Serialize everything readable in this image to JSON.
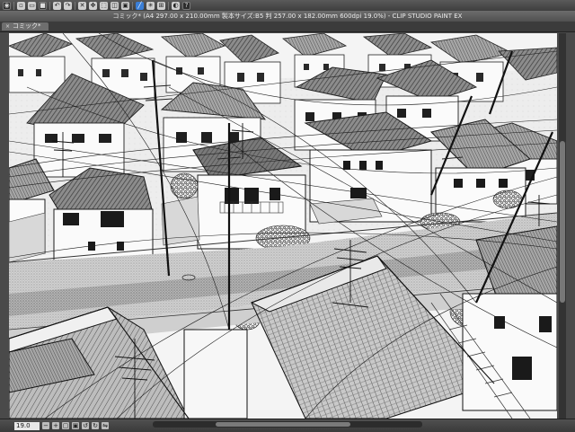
{
  "app": {
    "window_title": "コミック* (A4 297.00 x 210.00mm 製本サイズ:B5 判 257.00 x 182.00mm 600dpi 19.0%) - CLIP STUDIO PAINT EX"
  },
  "toolbar": {
    "icons": [
      "clip-studio-icon",
      "new-file-icon",
      "open-icon",
      "save-icon",
      "undo-icon",
      "redo-icon",
      "clear-icon",
      "transform-icon",
      "deselect-icon",
      "invert-icon",
      "border-icon",
      "snap-ruler-icon",
      "snap-special-ruler-icon",
      "snap-grid-icon",
      "color-icon",
      "help-icon"
    ]
  },
  "document_tab": {
    "label": "コミック*",
    "close": "×"
  },
  "statusbar": {
    "zoom": "19.0"
  },
  "colors": {
    "chrome_dark": "#3b3b3b",
    "chrome_mid": "#5a5a5a",
    "canvas_bg": "#f2f2f2",
    "accent": "#3a7ed6"
  }
}
